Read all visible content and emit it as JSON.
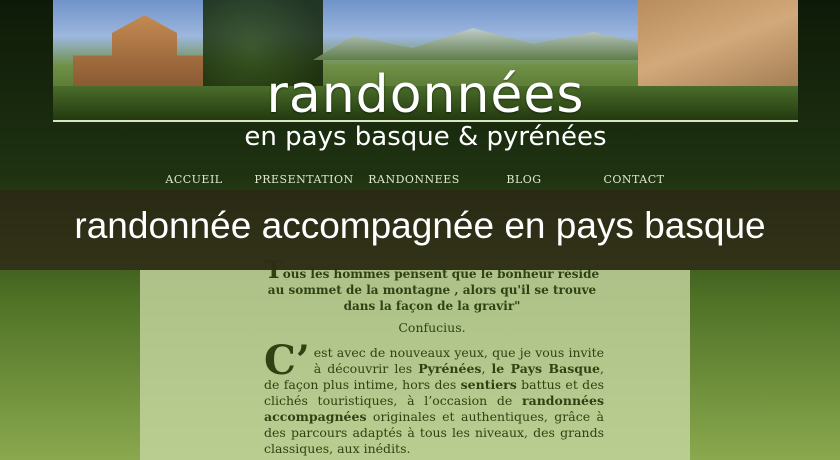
{
  "banner": {
    "title": "randonnées",
    "subtitle": "en pays basque & pyrénées"
  },
  "nav": {
    "items": [
      {
        "label": "ACCUEIL"
      },
      {
        "label": "PRESENTATION"
      },
      {
        "label": "RANDONNEES"
      },
      {
        "label": "BLOG"
      },
      {
        "label": "CONTACT"
      }
    ]
  },
  "headline": "randonnée accompagnée en pays basque",
  "quote": {
    "initial": "T",
    "text": "ous les hommes pensent que le bonheur réside au sommet de la montagne , alors qu'il se trouve dans la façon de la gravir\"",
    "author": "Confucius."
  },
  "body": {
    "drop_cap": "C’",
    "p1": "est avec de nouveaux yeux, que je vous invite à découvrir les ",
    "k1": "Pyrénées",
    "p2": ", ",
    "k2": "le Pays Basque",
    "p3": ", de façon plus intime, hors des ",
    "k3": "sentiers",
    "p4": " battus et des clichés touristiques, à l’occasion de ",
    "k4": "randonnées accompagnées",
    "p5": " originales et authentiques, grâce à des parcours adaptés à tous les niveaux, des grands classiques, aux inédits."
  }
}
